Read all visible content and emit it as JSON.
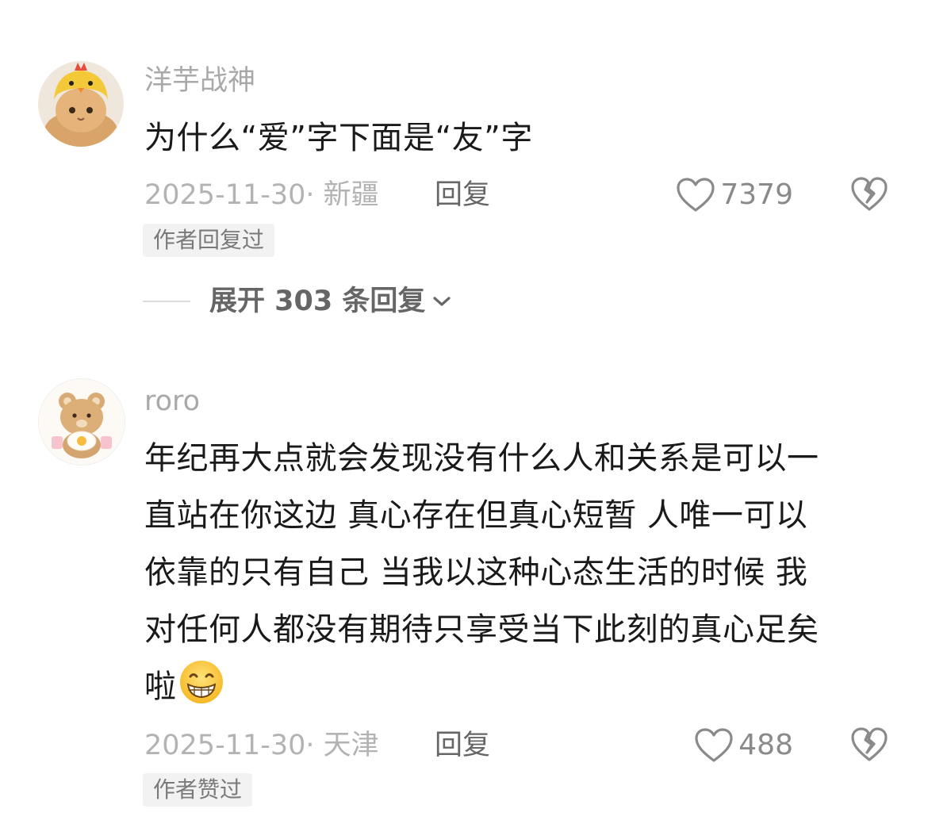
{
  "comments": [
    {
      "username": "洋芋战神",
      "content_lines": [
        "为什么“爱”字下面是“友”字"
      ],
      "meta": "2025-11-30· 新疆",
      "reply_label": "回复",
      "like_count": "7379",
      "tag": "作者回复过",
      "expand_label": "展开 303 条回复",
      "avatar_icon": "chick-hat-cat-avatar"
    },
    {
      "username": "roro",
      "content_lines": [
        "年纪再大点就会发现没有什么人和关系是可以一",
        "直站在你这边 真心存在但真心短暂 人唯一可以",
        "依靠的只有自己 当我以这种心态生活的时候 我",
        "对任何人都没有期待只享受当下此刻的真心足矣",
        "啦"
      ],
      "meta": "2025-11-30· 天津",
      "reply_label": "回复",
      "like_count": "488",
      "tag": "作者赞过",
      "avatar_icon": "bear-avatar",
      "emoji_icon": "grinning-emoji"
    }
  ],
  "colors": {
    "username": "#a9a9a9",
    "content": "#1a1a1a",
    "meta": "#b3b3b3",
    "reply": "#666666",
    "tag_bg": "#f2f2f2"
  }
}
